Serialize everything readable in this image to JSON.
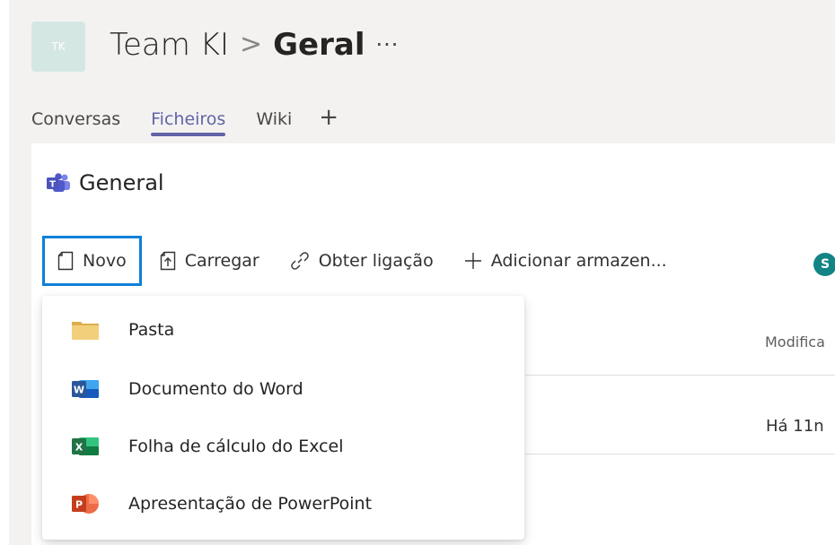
{
  "header": {
    "avatar_initials": "TK",
    "team_name": "Team KI",
    "separator": ">",
    "channel_name": "Geral",
    "more": "···"
  },
  "tabs": [
    {
      "label": "Conversas"
    },
    {
      "label": "Ficheiros"
    },
    {
      "label": "Wiki"
    }
  ],
  "tab_add": "+",
  "folder": {
    "title": "General",
    "icon": "teams-logo-icon"
  },
  "toolbar": {
    "new_label": "Novo",
    "upload_label": "Carregar",
    "get_link_label": "Obter ligação",
    "add_storage_label": "Adicionar armazen...",
    "sharepoint_icon": "S"
  },
  "table": {
    "modified_header": "Modifica",
    "modified_value": "Há 11n"
  },
  "menu": {
    "items": [
      {
        "label": "Pasta",
        "icon": "folder-icon"
      },
      {
        "label": "Documento do Word",
        "icon": "word-icon"
      },
      {
        "label": "Folha de cálculo do Excel",
        "icon": "excel-icon"
      },
      {
        "label": "Apresentação de PowerPoint",
        "icon": "powerpoint-icon"
      }
    ]
  },
  "colors": {
    "accent": "#6264a7",
    "focus": "#0f80d7",
    "word": "#2b579a",
    "excel": "#217346",
    "powerpoint": "#d24726",
    "folder": "#f2cf7b"
  }
}
